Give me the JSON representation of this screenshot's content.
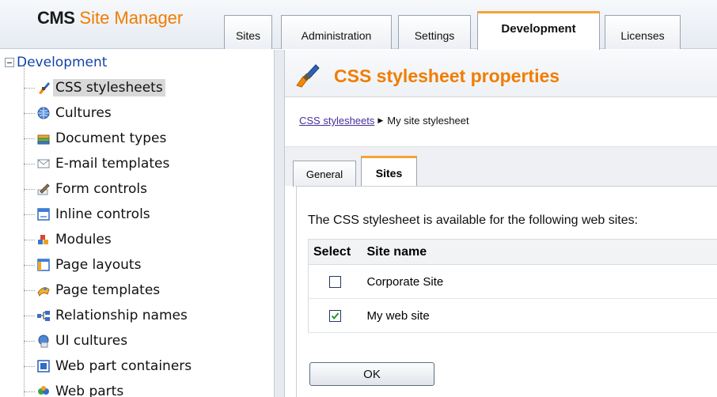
{
  "header": {
    "logo_brand": "CMS",
    "logo_product": "Site Manager",
    "tabs": [
      {
        "label": "Sites",
        "active": false
      },
      {
        "label": "Administration",
        "active": false
      },
      {
        "label": "Settings",
        "active": false
      },
      {
        "label": "Development",
        "active": true
      },
      {
        "label": "Licenses",
        "active": false
      }
    ]
  },
  "sidebar": {
    "root_label": "Development",
    "items": [
      {
        "label": "CSS stylesheets",
        "icon": "brush-icon",
        "selected": true
      },
      {
        "label": "Cultures",
        "icon": "globe-icon",
        "selected": false
      },
      {
        "label": "Document types",
        "icon": "document-stack-icon",
        "selected": false
      },
      {
        "label": "E-mail templates",
        "icon": "envelope-icon",
        "selected": false
      },
      {
        "label": "Form controls",
        "icon": "pencil-form-icon",
        "selected": false
      },
      {
        "label": "Inline controls",
        "icon": "window-icon",
        "selected": false
      },
      {
        "label": "Modules",
        "icon": "modules-icon",
        "selected": false
      },
      {
        "label": "Page layouts",
        "icon": "layout-icon",
        "selected": false
      },
      {
        "label": "Page templates",
        "icon": "page-templates-icon",
        "selected": false
      },
      {
        "label": "Relationship names",
        "icon": "relationship-icon",
        "selected": false
      },
      {
        "label": "UI cultures",
        "icon": "ui-cultures-icon",
        "selected": false
      },
      {
        "label": "Web part containers",
        "icon": "container-icon",
        "selected": false
      },
      {
        "label": "Web parts",
        "icon": "webparts-icon",
        "selected": false
      }
    ]
  },
  "content": {
    "title": "CSS stylesheet properties",
    "title_icon": "brush-icon",
    "breadcrumb": {
      "link": "CSS stylesheets",
      "separator": "▶",
      "current": "My site stylesheet"
    },
    "tabs": [
      {
        "label": "General",
        "active": false
      },
      {
        "label": "Sites",
        "active": true
      }
    ],
    "intro_text": "The CSS stylesheet is available for the following web sites:",
    "table": {
      "headers": {
        "select": "Select",
        "name": "Site name"
      },
      "rows": [
        {
          "name": "Corporate Site",
          "checked": false
        },
        {
          "name": "My web site",
          "checked": true
        }
      ]
    },
    "ok_label": "OK"
  },
  "colors": {
    "accent_orange": "#f07d00",
    "tab_highlight": "#f5a339",
    "link": "#4a2f99",
    "tree_root": "#1244a8"
  }
}
